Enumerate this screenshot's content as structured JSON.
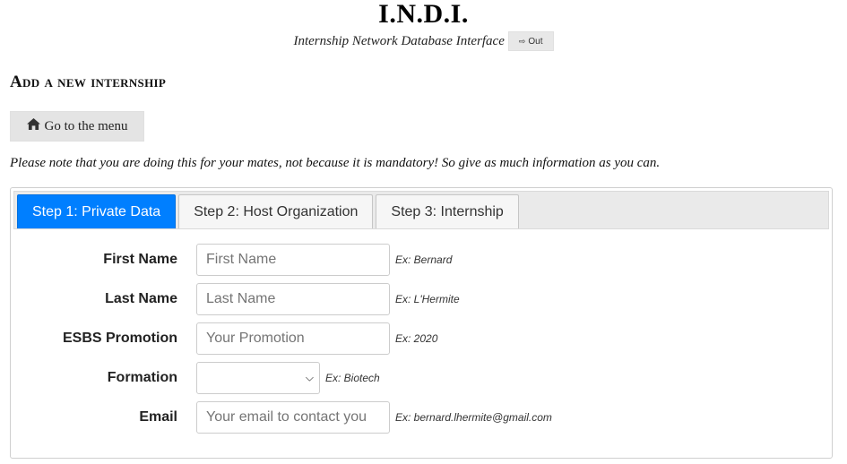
{
  "header": {
    "title": "I.N.D.I.",
    "subtitle": "Internship Network Database Interface",
    "out_label": "Out",
    "out_icon": "sign-out-icon"
  },
  "page": {
    "heading": "Add a new internship",
    "menu_button_label": "Go to the menu",
    "menu_button_icon": "home-icon",
    "note": "Please note that you are doing this for your mates, not because it is mandatory! So give as much information as you can."
  },
  "wizard": {
    "tabs": [
      {
        "label": "Step 1: Private Data",
        "active": true
      },
      {
        "label": "Step 2: Host Organization",
        "active": false
      },
      {
        "label": "Step 3: Internship",
        "active": false
      }
    ],
    "fields": {
      "first_name": {
        "label": "First Name",
        "placeholder": "First Name",
        "value": "",
        "hint": "Ex: Bernard"
      },
      "last_name": {
        "label": "Last Name",
        "placeholder": "Last Name",
        "value": "",
        "hint": "Ex: L'Hermite"
      },
      "promotion": {
        "label": "ESBS Promotion",
        "placeholder": "Your Promotion",
        "value": "",
        "hint": "Ex: 2020"
      },
      "formation": {
        "label": "Formation",
        "selected": "",
        "hint": "Ex: Biotech"
      },
      "email": {
        "label": "Email",
        "placeholder": "Your email to contact you",
        "value": "",
        "hint": "Ex: bernard.lhermite@gmail.com"
      }
    }
  },
  "colors": {
    "active_tab": "#007fff",
    "tab_bar": "#eaeaea"
  }
}
